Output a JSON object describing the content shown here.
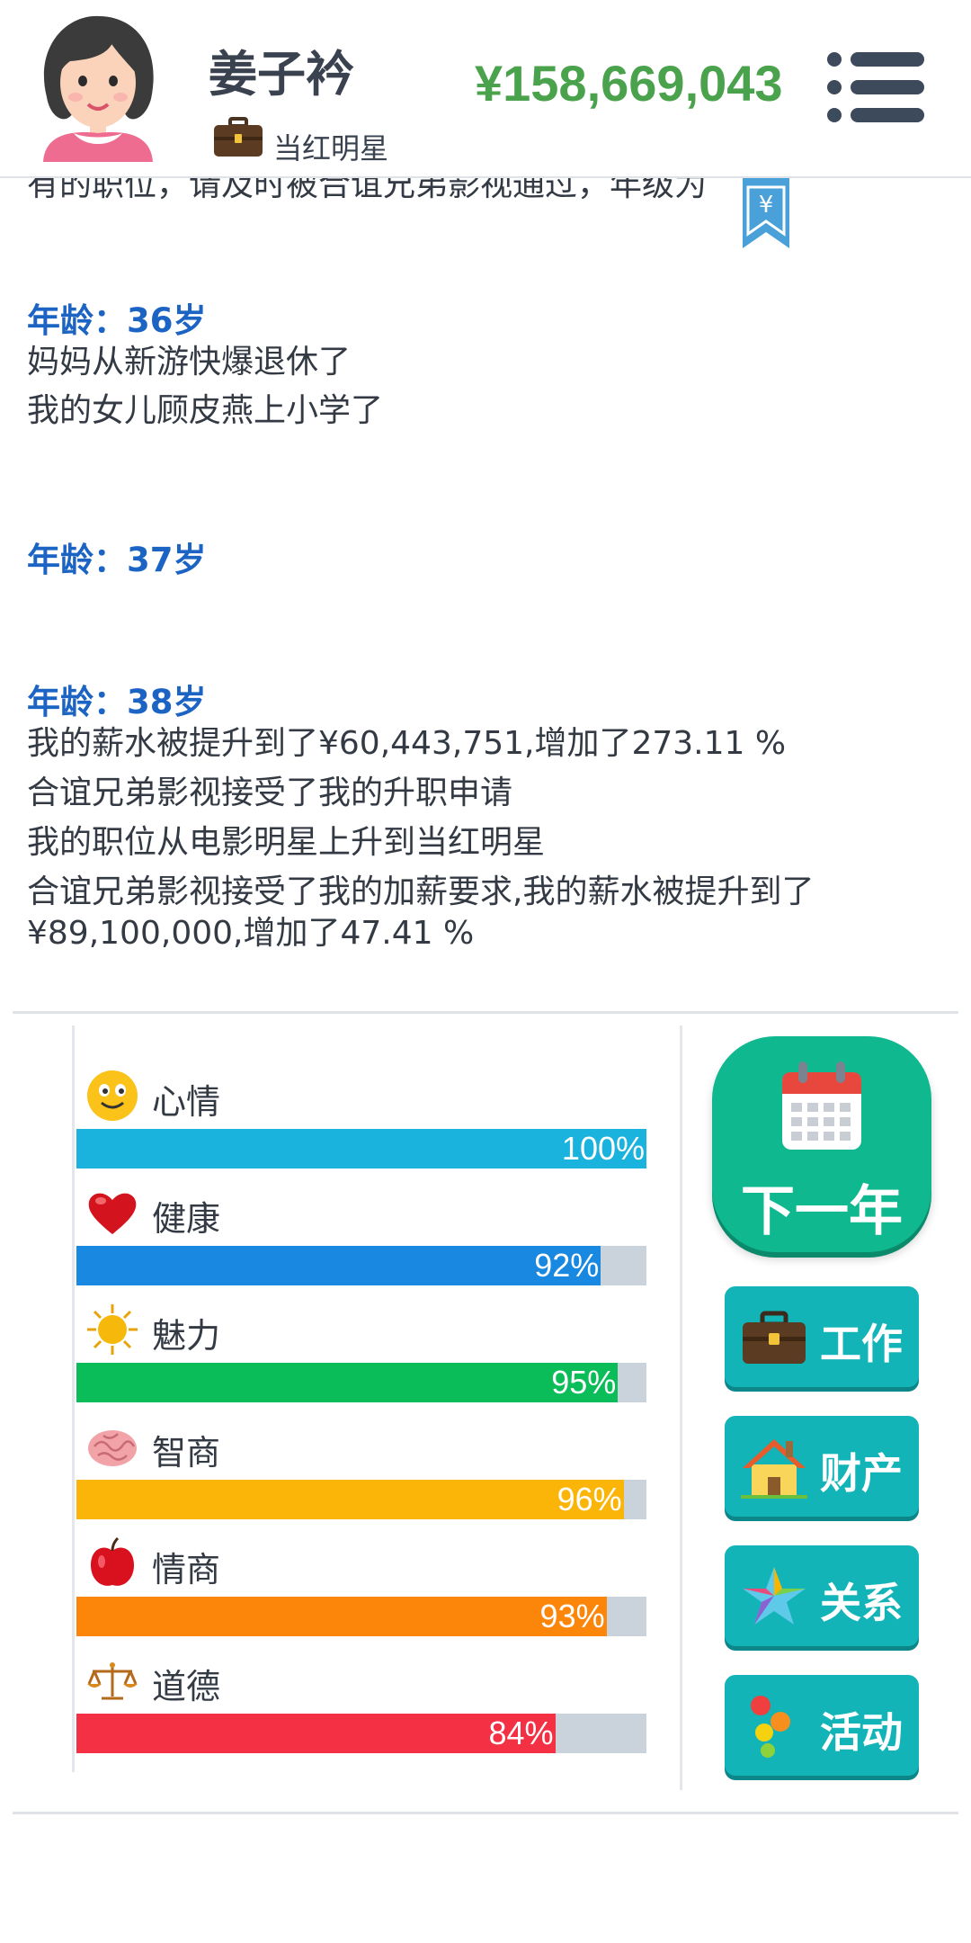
{
  "header": {
    "name": "姜子衿",
    "job_title": "当红明星",
    "money": "¥158,669,043",
    "menu_icon": "hamburger-menu-icon"
  },
  "log": {
    "cut_line": "有的职位，请及时被合谊兄弟影视通过，年级为",
    "entries": [
      {
        "age": "年龄：36岁",
        "lines": [
          "妈妈从新游快爆退休了",
          "我的女儿顾皮燕上小学了"
        ]
      },
      {
        "age": "年龄：37岁",
        "lines": []
      },
      {
        "age": "年龄：38岁",
        "lines": [
          "我的薪水被提升到了¥60,443,751,增加了273.11 %",
          "合谊兄弟影视接受了我的升职申请",
          "我的职位从电影明星上升到当红明星",
          "合谊兄弟影视接受了我的加薪要求,我的薪水被提升到了¥89,100,000,增加了47.41 %"
        ]
      }
    ]
  },
  "stats": [
    {
      "name": "心情",
      "percent": 100,
      "label": "100%",
      "color": "#19b3dd",
      "icon": "smiley-face-icon"
    },
    {
      "name": "健康",
      "percent": 92,
      "label": "92%",
      "color": "#1888e0",
      "icon": "heart-icon"
    },
    {
      "name": "魅力",
      "percent": 95,
      "label": "95%",
      "color": "#0bbd58",
      "icon": "sun-icon"
    },
    {
      "name": "智商",
      "percent": 96,
      "label": "96%",
      "color": "#fbb509",
      "icon": "brain-icon"
    },
    {
      "name": "情商",
      "percent": 93,
      "label": "93%",
      "color": "#fb8609",
      "icon": "apple-icon"
    },
    {
      "name": "道德",
      "percent": 84,
      "label": "84%",
      "color": "#f43144",
      "icon": "scales-icon"
    }
  ],
  "actions": {
    "next_year": "下一年",
    "work": "工作",
    "property": "财产",
    "relations": "关系",
    "activities": "活动"
  },
  "colors": {
    "money": "#4aa24c",
    "age": "#1c64c4",
    "next_button": "#0fb88f",
    "action_button": "#12b4b8"
  }
}
